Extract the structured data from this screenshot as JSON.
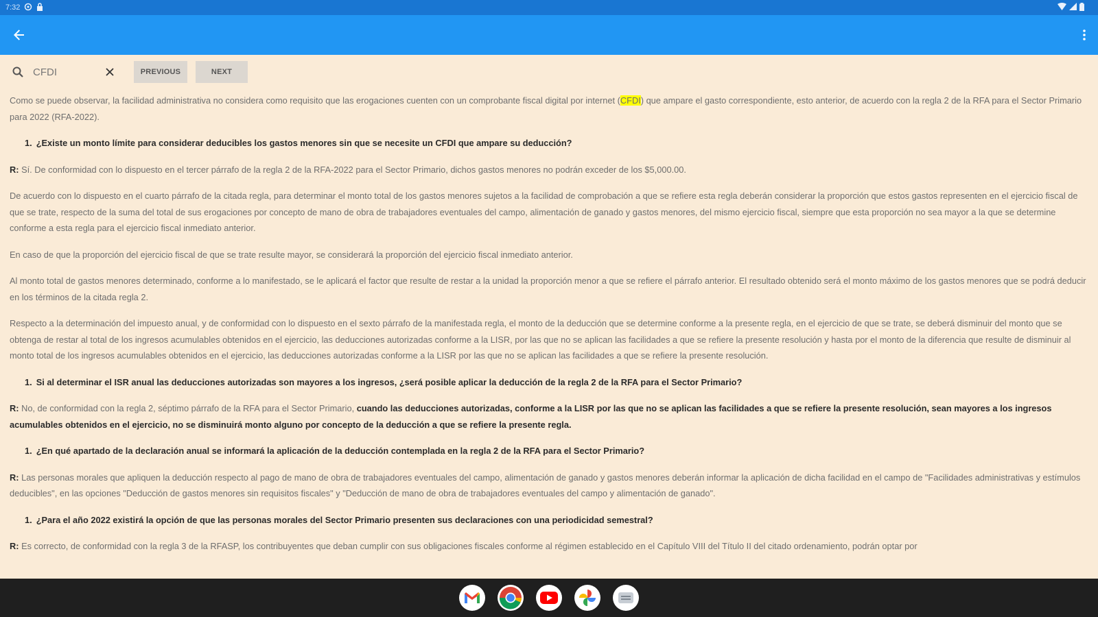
{
  "status_bar": {
    "time": "7:32"
  },
  "search": {
    "value": "CFDI",
    "previous_label": "PREVIOUS",
    "next_label": "NEXT"
  },
  "content": {
    "p1_before": "Como se puede observar, la facilidad administrativa no considera como requisito que las erogaciones cuenten con un comprobante fiscal digital por internet (",
    "p1_highlight": "CFDI",
    "p1_after": ") que ampare el gasto correspondiente, esto anterior, de acuerdo con la regla 2 de la RFA para el Sector Primario para 2022 (RFA-2022).",
    "q1_num": "1.",
    "q1": "¿Existe un monto límite para considerar deducibles los gastos menores sin que se necesite un CFDI que ampare su deducción?",
    "a1_r": "R:",
    "a1": " Sí. De conformidad con lo dispuesto en el tercer párrafo de la regla 2 de la RFA-2022 para el Sector Primario, dichos gastos menores no podrán exceder de los $5,000.00.",
    "p2": "De acuerdo con lo dispuesto en el cuarto párrafo de la citada regla, para determinar el monto total de los gastos menores sujetos a la facilidad de comprobación a que se refiere esta regla deberán considerar la proporción que estos gastos representen en el ejercicio fiscal de que se trate, respecto de la suma del total de sus erogaciones por concepto de mano de obra de trabajadores eventuales del campo, alimentación de ganado y gastos menores, del mismo ejercicio fiscal, siempre que esta proporción no sea mayor a la que se determine conforme a esta regla para el ejercicio fiscal inmediato anterior.",
    "p3": "En caso de que la proporción del ejercicio fiscal de que se trate resulte mayor, se considerará la proporción del ejercicio fiscal inmediato anterior.",
    "p4": "Al monto total de gastos menores determinado, conforme a lo manifestado, se le aplicará el factor que resulte de restar a la unidad la proporción menor a que se refiere el párrafo anterior. El resultado obtenido será el monto máximo de los gastos menores que se podrá deducir en los términos de la citada regla 2.",
    "p5": "Respecto a la determinación del impuesto anual, y de conformidad con lo dispuesto en el sexto párrafo de la manifestada regla, el monto de la deducción que se determine conforme a la presente regla, en el ejercicio de que se trate, se deberá disminuir del monto que se obtenga de restar al total de los ingresos acumulables obtenidos en el ejercicio, las deducciones autorizadas conforme a la LISR, por las que no se aplican las facilidades a que se refiere la presente resolución y hasta por el monto de la diferencia que resulte de disminuir al monto total de los ingresos acumulables obtenidos en el ejercicio, las deducciones autorizadas conforme a la LISR por las que no se aplican las facilidades a que se refiere la presente resolución.",
    "q2_num": "1.",
    "q2": "Si al determinar el ISR anual las deducciones autorizadas son mayores a los ingresos, ¿será posible aplicar la deducción de la regla 2 de la RFA para el Sector Primario?",
    "a2_r": "R:",
    "a2_normal": " No, de conformidad con la regla 2, séptimo párrafo de la RFA para el Sector Primario, ",
    "a2_bold": "cuando las deducciones autorizadas, conforme a la LISR por las que no se aplican las facilidades a que se refiere la presente resolución, sean mayores a los ingresos acumulables obtenidos en el ejercicio, no se disminuirá monto alguno por concepto de la deducción a que se refiere la presente regla.",
    "q3_num": "1.",
    "q3": "¿En qué apartado de la declaración anual se informará la aplicación de la deducción contemplada en la regla 2 de la RFA para el Sector Primario?",
    "a3_r": "R:",
    "a3": " Las personas morales que apliquen la deducción respecto al pago de mano de obra de trabajadores eventuales del campo, alimentación de ganado y gastos menores deberán informar la aplicación de dicha facilidad en el campo de \"Facilidades administrativas y estímulos deducibles\", en las opciones \"Deducción de gastos menores sin requisitos fiscales\" y \"Deducción de mano de obra de trabajadores eventuales del campo y alimentación de ganado\".",
    "q4_num": "1.",
    "q4": "¿Para el año 2022 existirá la opción de que las personas morales del Sector Primario presenten sus declaraciones con una periodicidad semestral?",
    "a4_r": "R:",
    "a4": " Es correcto, de conformidad con la regla 3 de la RFASP, los contribuyentes que deban cumplir con sus obligaciones fiscales conforme al régimen establecido en el Capítulo VIII del Título II del citado ordenamiento, podrán optar por"
  },
  "colors": {
    "status_bar": "#1976d2",
    "app_bar": "#2196f3",
    "background": "#faebd7",
    "highlight": "#ffff00",
    "taskbar": "#1f1f1f"
  },
  "icons": [
    "back-arrow-icon",
    "overflow-menu-icon",
    "search-icon",
    "close-icon",
    "gmail-icon",
    "chrome-icon",
    "youtube-icon",
    "photos-icon",
    "messages-icon"
  ]
}
